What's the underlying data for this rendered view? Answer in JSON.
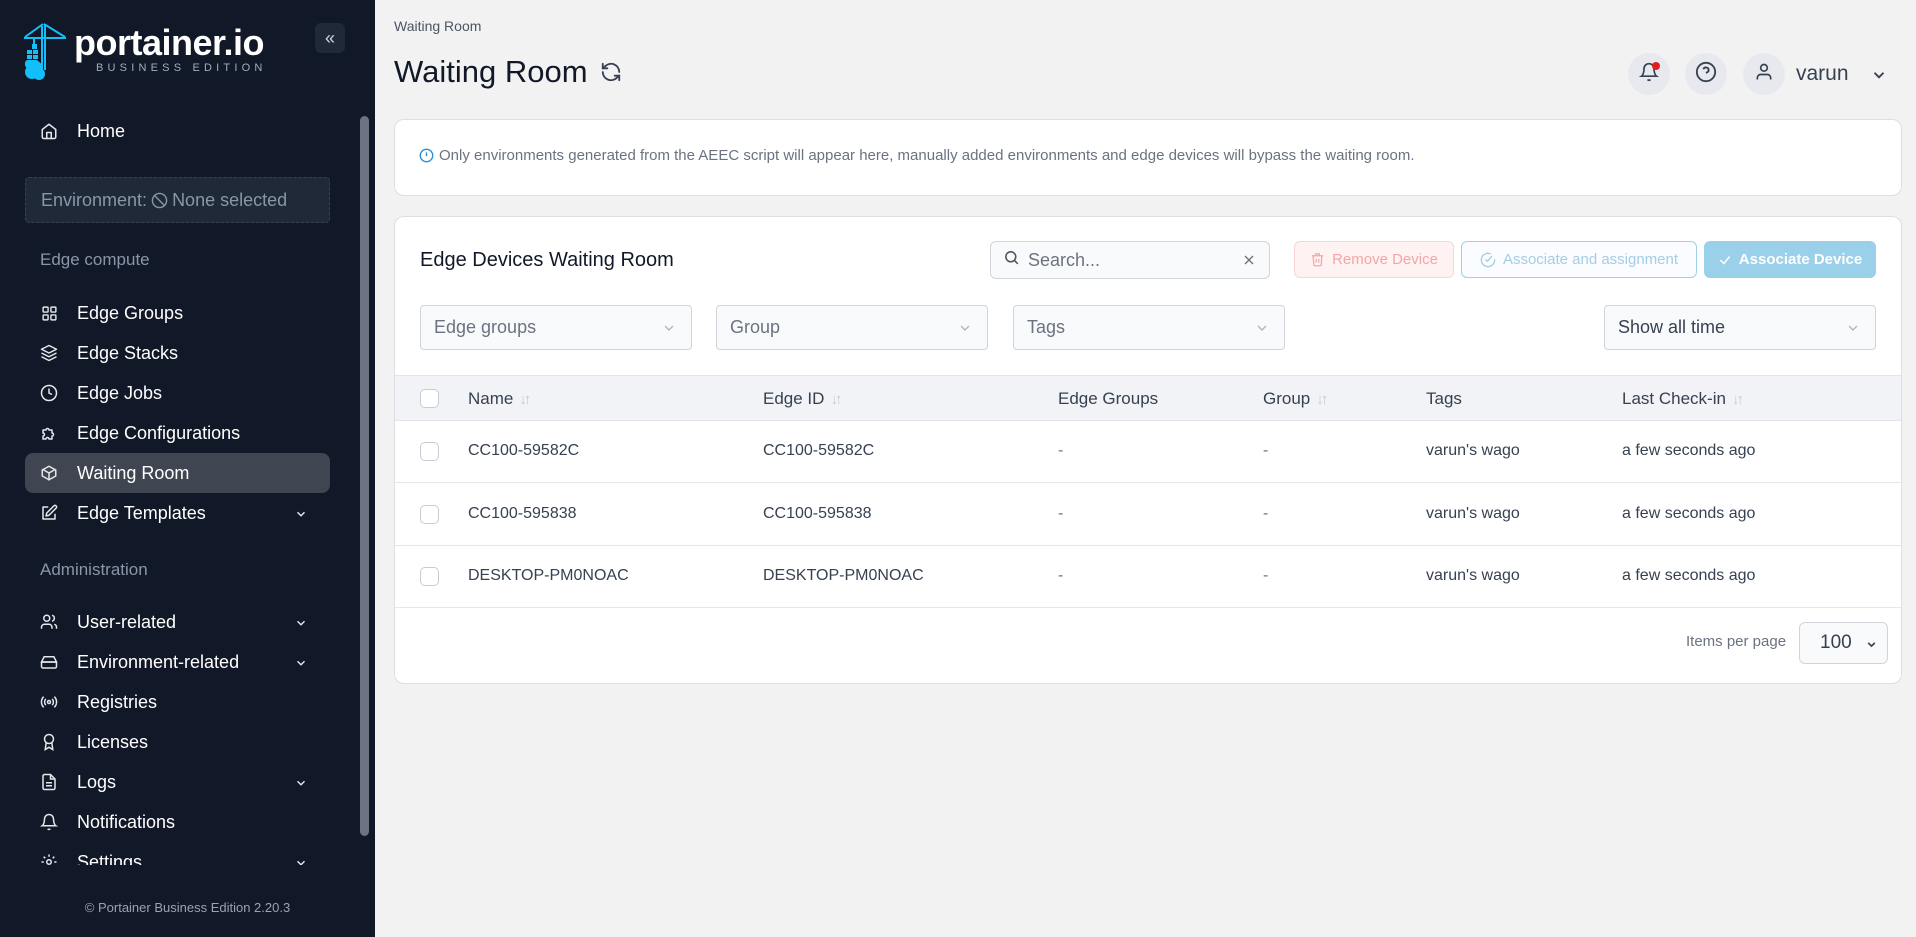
{
  "app": {
    "logo_text": "portainer.io",
    "logo_subtitle": "BUSINESS EDITION",
    "footer": "© Portainer Business Edition  2.20.3"
  },
  "sidebar": {
    "home": "Home",
    "environment_label": "Environment:",
    "environment_value": "None selected",
    "sections": {
      "edge": "Edge compute",
      "admin": "Administration"
    },
    "edge_items": [
      {
        "label": "Edge Groups",
        "icon": "grid-icon"
      },
      {
        "label": "Edge Stacks",
        "icon": "layers-icon"
      },
      {
        "label": "Edge Jobs",
        "icon": "clock-icon"
      },
      {
        "label": "Edge Configurations",
        "icon": "puzzle-icon"
      },
      {
        "label": "Waiting Room",
        "icon": "box-icon",
        "active": true
      },
      {
        "label": "Edge Templates",
        "icon": "edit-icon",
        "expandable": true
      }
    ],
    "admin_items": [
      {
        "label": "User-related",
        "icon": "users-icon",
        "expandable": true
      },
      {
        "label": "Environment-related",
        "icon": "hard-drive-icon",
        "expandable": true
      },
      {
        "label": "Registries",
        "icon": "radio-icon"
      },
      {
        "label": "Licenses",
        "icon": "award-icon"
      },
      {
        "label": "Logs",
        "icon": "file-text-icon",
        "expandable": true
      },
      {
        "label": "Notifications",
        "icon": "bell-icon"
      },
      {
        "label": "Settings",
        "icon": "gear-icon",
        "expandable": true
      }
    ]
  },
  "header": {
    "breadcrumb": "Waiting Room",
    "title": "Waiting Room",
    "user": "varun"
  },
  "info": {
    "text": "Only environments generated from the AEEC script will appear here, manually added environments and edge devices will bypass the waiting room."
  },
  "table": {
    "title": "Edge Devices Waiting Room",
    "search_placeholder": "Search...",
    "buttons": {
      "remove": "Remove Device",
      "associate_assign": "Associate and assignment",
      "associate": "Associate Device"
    },
    "filters": {
      "edge_groups": "Edge groups",
      "group": "Group",
      "tags": "Tags",
      "time": "Show all time"
    },
    "columns": [
      "Name",
      "Edge ID",
      "Edge Groups",
      "Group",
      "Tags",
      "Last Check-in"
    ],
    "rows": [
      {
        "name": "CC100-59582C",
        "edge_id": "CC100-59582C",
        "edge_groups": "-",
        "group": "-",
        "tags": "varun's wago",
        "last_checkin": "a few seconds ago"
      },
      {
        "name": "CC100-595838",
        "edge_id": "CC100-595838",
        "edge_groups": "-",
        "group": "-",
        "tags": "varun's wago",
        "last_checkin": "a few seconds ago"
      },
      {
        "name": "DESKTOP-PM0NOAC",
        "edge_id": "DESKTOP-PM0NOAC",
        "edge_groups": "-",
        "group": "-",
        "tags": "varun's wago",
        "last_checkin": "a few seconds ago"
      }
    ],
    "items_per_page_label": "Items per page",
    "items_per_page": "100"
  },
  "colors": {
    "sidebar_bg": "#111827",
    "active_item": "#3f4652",
    "primary": "#9ad0ea",
    "danger_light": "#fef2f2",
    "notification_dot": "#e11d1d"
  }
}
